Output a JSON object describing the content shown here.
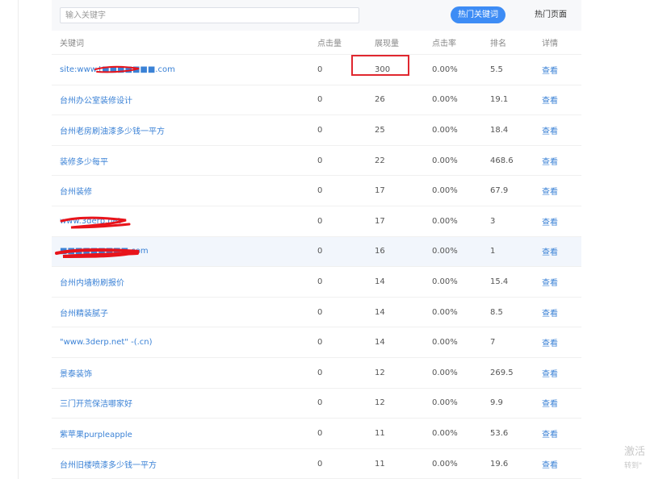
{
  "search": {
    "placeholder": "输入关键字"
  },
  "tabs": {
    "hot_keywords": "热门关键词",
    "hot_pages": "热门页面"
  },
  "columns": {
    "keyword": "关键词",
    "clicks": "点击量",
    "impressions": "展现量",
    "ctr": "点击率",
    "rank": "排名",
    "detail": "详情"
  },
  "rows": [
    {
      "keyword": "site:www.t■■■■■■■.com",
      "clicks": "0",
      "impressions": "300",
      "ctr": "0.00%",
      "rank": "5.5",
      "detail": "查看"
    },
    {
      "keyword": "台州办公室装修设计",
      "clicks": "0",
      "impressions": "26",
      "ctr": "0.00%",
      "rank": "19.1",
      "detail": "查看"
    },
    {
      "keyword": "台州老房刷油漆多少钱一平方",
      "clicks": "0",
      "impressions": "25",
      "ctr": "0.00%",
      "rank": "18.4",
      "detail": "查看"
    },
    {
      "keyword": "装修多少每平",
      "clicks": "0",
      "impressions": "22",
      "ctr": "0.00%",
      "rank": "468.6",
      "detail": "查看"
    },
    {
      "keyword": "台州装修",
      "clicks": "0",
      "impressions": "17",
      "ctr": "0.00%",
      "rank": "67.9",
      "detail": "查看"
    },
    {
      "keyword": "www.3derp.net",
      "clicks": "0",
      "impressions": "17",
      "ctr": "0.00%",
      "rank": "3",
      "detail": "查看"
    },
    {
      "keyword": "■■■■■■■■■.com",
      "clicks": "0",
      "impressions": "16",
      "ctr": "0.00%",
      "rank": "1",
      "detail": "查看"
    },
    {
      "keyword": "台州内墙粉刷报价",
      "clicks": "0",
      "impressions": "14",
      "ctr": "0.00%",
      "rank": "15.4",
      "detail": "查看"
    },
    {
      "keyword": "台州精装腻子",
      "clicks": "0",
      "impressions": "14",
      "ctr": "0.00%",
      "rank": "8.5",
      "detail": "查看"
    },
    {
      "keyword": "\"www.3derp.net\" -(.cn)",
      "clicks": "0",
      "impressions": "14",
      "ctr": "0.00%",
      "rank": "7",
      "detail": "查看"
    },
    {
      "keyword": "景泰装饰",
      "clicks": "0",
      "impressions": "12",
      "ctr": "0.00%",
      "rank": "269.5",
      "detail": "查看"
    },
    {
      "keyword": "三门开荒保洁哪家好",
      "clicks": "0",
      "impressions": "12",
      "ctr": "0.00%",
      "rank": "9.9",
      "detail": "查看"
    },
    {
      "keyword": "紫苹果purpleapple",
      "clicks": "0",
      "impressions": "11",
      "ctr": "0.00%",
      "rank": "53.6",
      "detail": "查看"
    },
    {
      "keyword": "台州旧楼喷漆多少钱一平方",
      "clicks": "0",
      "impressions": "11",
      "ctr": "0.00%",
      "rank": "19.6",
      "detail": "查看"
    }
  ],
  "watermark": {
    "line1": "激活",
    "line2": "转到\""
  },
  "colors": {
    "accent": "#3d8cf5",
    "link": "#3b82d6",
    "highlight_box": "#e0272f",
    "redaction": "#e8141b"
  }
}
